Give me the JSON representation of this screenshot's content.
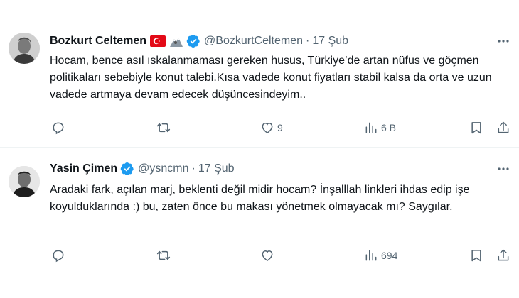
{
  "tweets": [
    {
      "name": "Bozkurt Celtemen",
      "emoji_badges": [
        "turkish-flag",
        "mountain-wolf"
      ],
      "handle": "@BozkurtCeltemen",
      "separator": "·",
      "date": "17 Şub",
      "text": "Hocam, bence asıl ıskalanmaması gereken husus, Türkiye’de artan nüfus ve göçmen politikaları sebebiyle konut talebi.Kısa vadede konut fiyatları stabil kalsa da orta ve uzun vadede artmaya devam edecek düşüncesindeyim..",
      "actions": {
        "replies": "",
        "retweets": "",
        "likes": "9",
        "views": "6 B"
      }
    },
    {
      "name": "Yasin Çimen",
      "handle": "@ysncmn",
      "separator": "·",
      "date": "17 Şub",
      "text": "Aradaki fark, açılan marj, beklenti değil midir hocam? İnşalllah linkleri ihdas edip işe koyulduklarında :) bu, zaten önce bu makası yönetmek olmayacak mı? Saygılar.",
      "actions": {
        "replies": "",
        "retweets": "",
        "likes": "",
        "views": "694"
      }
    }
  ],
  "icons": {
    "verified": "verified-badge-icon",
    "more": "more-dots-icon",
    "reply": "reply-icon",
    "retweet": "retweet-icon",
    "like": "heart-icon",
    "views": "views-icon",
    "bookmark": "bookmark-icon",
    "share": "share-icon"
  },
  "colors": {
    "verified_blue": "#1d9bf0",
    "text": "#0f1419",
    "secondary": "#536471",
    "divider": "#eff3f4"
  }
}
